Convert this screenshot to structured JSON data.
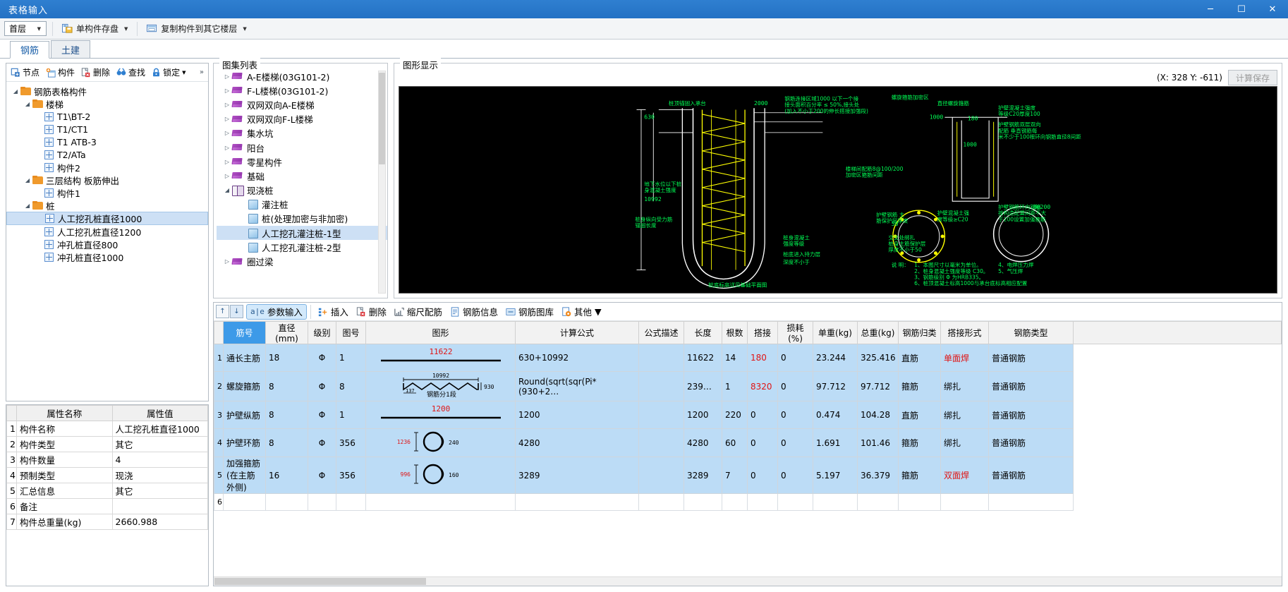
{
  "window": {
    "title": "表格输入",
    "minimize": "─",
    "maximize": "☐",
    "close": "✕"
  },
  "ribbon": {
    "floor_select": "首层",
    "buttons": [
      {
        "label": "单构件存盘",
        "icon": "save-component-icon",
        "has_arrow": true
      },
      {
        "label": "复制构件到其它楼层",
        "icon": "copy-component-icon",
        "has_arrow": true
      }
    ]
  },
  "tabs": [
    {
      "label": "钢筋",
      "active": true
    },
    {
      "label": "土建",
      "active": false
    }
  ],
  "tree_toolbar": {
    "buttons": [
      {
        "label": "节点",
        "icon": "node-icon",
        "has_arrow": false
      },
      {
        "label": "构件",
        "icon": "component-icon",
        "has_arrow": false
      },
      {
        "label": "删除",
        "icon": "delete-icon",
        "has_arrow": false
      },
      {
        "label": "查找",
        "icon": "find-icon",
        "has_arrow": false
      },
      {
        "label": "锁定",
        "icon": "lock-icon",
        "has_arrow": true
      }
    ],
    "overflow": "»"
  },
  "tree": [
    {
      "label": "钢筋表格构件",
      "type": "folder",
      "depth": 0,
      "expanded": true,
      "selected": false
    },
    {
      "label": "楼梯",
      "type": "folder",
      "depth": 1,
      "expanded": true,
      "selected": false
    },
    {
      "label": "T1\\BT-2",
      "type": "component",
      "depth": 2,
      "expanded": false,
      "selected": false
    },
    {
      "label": "T1/CT1",
      "type": "component",
      "depth": 2,
      "expanded": false,
      "selected": false
    },
    {
      "label": "T1 ATB-3",
      "type": "component",
      "depth": 2,
      "expanded": false,
      "selected": false
    },
    {
      "label": "T2/ATa",
      "type": "component",
      "depth": 2,
      "expanded": false,
      "selected": false
    },
    {
      "label": "构件2",
      "type": "component",
      "depth": 2,
      "expanded": false,
      "selected": false
    },
    {
      "label": "三层结构 板筋伸出",
      "type": "folder",
      "depth": 1,
      "expanded": true,
      "selected": false
    },
    {
      "label": "构件1",
      "type": "component",
      "depth": 2,
      "expanded": false,
      "selected": false
    },
    {
      "label": "桩",
      "type": "folder",
      "depth": 1,
      "expanded": true,
      "selected": false
    },
    {
      "label": "人工挖孔桩直径1000",
      "type": "component",
      "depth": 2,
      "expanded": false,
      "selected": true
    },
    {
      "label": "人工挖孔桩直径1200",
      "type": "component",
      "depth": 2,
      "expanded": false,
      "selected": false
    },
    {
      "label": "冲孔桩直径800",
      "type": "component",
      "depth": 2,
      "expanded": false,
      "selected": false
    },
    {
      "label": "冲孔桩直径1000",
      "type": "component",
      "depth": 2,
      "expanded": false,
      "selected": false
    }
  ],
  "properties": {
    "headers": [
      "",
      "属性名称",
      "属性值"
    ],
    "rows": [
      {
        "n": "1",
        "name": "构件名称",
        "value": "人工挖孔桩直径1000"
      },
      {
        "n": "2",
        "name": "构件类型",
        "value": "其它"
      },
      {
        "n": "3",
        "name": "构件数量",
        "value": "4"
      },
      {
        "n": "4",
        "name": "预制类型",
        "value": "现浇"
      },
      {
        "n": "5",
        "name": "汇总信息",
        "value": "其它"
      },
      {
        "n": "6",
        "name": "备注",
        "value": ""
      },
      {
        "n": "7",
        "name": "构件总重量(kg)",
        "value": "2660.988"
      }
    ]
  },
  "atlas": {
    "caption": "图集列表",
    "items": [
      {
        "label": "A-E楼梯(03G101-2)",
        "icon": "book-icon",
        "depth": 0,
        "expanded": false,
        "selected": false
      },
      {
        "label": "F-L楼梯(03G101-2)",
        "icon": "book-icon",
        "depth": 0,
        "expanded": false,
        "selected": false
      },
      {
        "label": "双网双向A-E楼梯",
        "icon": "book-icon",
        "depth": 0,
        "expanded": false,
        "selected": false
      },
      {
        "label": "双网双向F-L楼梯",
        "icon": "book-icon",
        "depth": 0,
        "expanded": false,
        "selected": false
      },
      {
        "label": "集水坑",
        "icon": "book-icon",
        "depth": 0,
        "expanded": false,
        "selected": false
      },
      {
        "label": "阳台",
        "icon": "book-icon",
        "depth": 0,
        "expanded": false,
        "selected": false
      },
      {
        "label": "零星构件",
        "icon": "book-icon",
        "depth": 0,
        "expanded": false,
        "selected": false
      },
      {
        "label": "基础",
        "icon": "book-icon",
        "depth": 0,
        "expanded": false,
        "selected": false
      },
      {
        "label": "现浇桩",
        "icon": "book-open-icon",
        "depth": 0,
        "expanded": true,
        "selected": false
      },
      {
        "label": "灌注桩",
        "icon": "page-icon",
        "depth": 1,
        "expanded": null,
        "selected": false
      },
      {
        "label": "桩(处理加密与非加密)",
        "icon": "page-icon",
        "depth": 1,
        "expanded": null,
        "selected": false
      },
      {
        "label": "人工挖孔灌注桩-1型",
        "icon": "page-icon",
        "depth": 1,
        "expanded": null,
        "selected": true
      },
      {
        "label": "人工挖孔灌注桩-2型",
        "icon": "page-icon",
        "depth": 1,
        "expanded": null,
        "selected": false
      },
      {
        "label": "圈过梁",
        "icon": "book-icon",
        "depth": 0,
        "expanded": false,
        "selected": false
      }
    ]
  },
  "graphic": {
    "caption": "图形显示",
    "coordinates": "(X: 328 Y: -611)",
    "calc_button": "计算保存"
  },
  "rebar_toolbar": {
    "up": "↑",
    "down": "↓",
    "buttons": [
      {
        "label": "参数输入",
        "icon": "param-input-icon",
        "active": true,
        "has_arrow": false
      },
      {
        "label": "插入",
        "icon": "insert-icon",
        "active": false,
        "has_arrow": false
      },
      {
        "label": "删除",
        "icon": "delete-icon",
        "active": false,
        "has_arrow": false
      },
      {
        "label": "缩尺配筋",
        "icon": "scale-rebar-icon",
        "active": false,
        "has_arrow": false
      },
      {
        "label": "钢筋信息",
        "icon": "rebar-info-icon",
        "active": false,
        "has_arrow": false
      },
      {
        "label": "钢筋图库",
        "icon": "rebar-library-icon",
        "active": false,
        "has_arrow": false
      },
      {
        "label": "其他",
        "icon": "other-icon",
        "active": false,
        "has_arrow": true
      }
    ]
  },
  "rebar_table": {
    "headers": [
      "筋号",
      "直径(mm)",
      "级别",
      "图号",
      "图形",
      "计算公式",
      "公式描述",
      "长度",
      "根数",
      "搭接",
      "损耗(%)",
      "单重(kg)",
      "总重(kg)",
      "钢筋归类",
      "搭接形式",
      "钢筋类型"
    ],
    "rows": [
      {
        "n": "1",
        "name": "通长主筋",
        "diameter": "18",
        "grade": "Φ",
        "figure_no": "1",
        "shape_kind": "straight",
        "shape_label": "11622",
        "shape_label_color": "#e01414",
        "formula": "630+10992",
        "formula_desc": "",
        "length": "11622",
        "count": "14",
        "lap": "180",
        "lap_color": "#e01414",
        "loss": "0",
        "unit_weight": "23.244",
        "total_weight": "325.416",
        "category": "直筋",
        "lap_form": "单面焊",
        "lap_form_color": "#e01414",
        "rebar_type": "普通钢筋"
      },
      {
        "n": "2",
        "name": "螺旋箍筋",
        "diameter": "8",
        "grade": "Φ",
        "figure_no": "8",
        "shape_kind": "spiral",
        "shape_top": "10992",
        "shape_right": "930",
        "shape_bottom": "137",
        "shape_caption": "钢筋分1段",
        "formula": "Round(sqrt(sqr(Pi*(930+2…",
        "formula_desc": "",
        "length": "239…",
        "count": "1",
        "lap": "8320",
        "lap_color": "#e01414",
        "loss": "0",
        "unit_weight": "97.712",
        "total_weight": "97.712",
        "category": "箍筋",
        "lap_form": "绑扎",
        "lap_form_color": "#000000",
        "rebar_type": "普通钢筋"
      },
      {
        "n": "3",
        "name": "护壁纵筋",
        "diameter": "8",
        "grade": "Φ",
        "figure_no": "1",
        "shape_kind": "straight",
        "shape_label": "1200",
        "shape_label_color": "#e01414",
        "formula": "1200",
        "formula_desc": "",
        "length": "1200",
        "count": "220",
        "lap": "0",
        "lap_color": "#000000",
        "loss": "0",
        "unit_weight": "0.474",
        "total_weight": "104.28",
        "category": "直筋",
        "lap_form": "绑扎",
        "lap_form_color": "#000000",
        "rebar_type": "普通钢筋"
      },
      {
        "n": "4",
        "name": "护壁环筋",
        "diameter": "8",
        "grade": "Φ",
        "figure_no": "356",
        "shape_kind": "circle",
        "shape_left": "1236",
        "shape_right": "240",
        "formula": "4280",
        "formula_desc": "",
        "length": "4280",
        "count": "60",
        "lap": "0",
        "lap_color": "#000000",
        "loss": "0",
        "unit_weight": "1.691",
        "total_weight": "101.46",
        "category": "箍筋",
        "lap_form": "绑扎",
        "lap_form_color": "#000000",
        "rebar_type": "普通钢筋"
      },
      {
        "n": "5",
        "name": "加强箍筋(在主筋外侧)",
        "diameter": "16",
        "grade": "Φ",
        "figure_no": "356",
        "shape_kind": "circle",
        "shape_left": "996",
        "shape_right": "160",
        "formula": "3289",
        "formula_desc": "",
        "length": "3289",
        "count": "7",
        "lap": "0",
        "lap_color": "#000000",
        "loss": "0",
        "unit_weight": "5.197",
        "total_weight": "36.379",
        "category": "箍筋",
        "lap_form": "双面焊",
        "lap_form_color": "#e01414",
        "rebar_type": "普通钢筋"
      },
      {
        "n": "6",
        "name": "",
        "diameter": "",
        "grade": "",
        "figure_no": "",
        "shape_kind": "none",
        "formula": "",
        "formula_desc": "",
        "length": "",
        "count": "",
        "lap": "",
        "loss": "",
        "unit_weight": "",
        "total_weight": "",
        "category": "",
        "lap_form": "",
        "rebar_type": "",
        "empty": true
      }
    ]
  },
  "colors": {
    "title_bar": "#2472c4",
    "selection": "#cde0f5",
    "row_fill": "#bcdcf6",
    "accent_red": "#e01414",
    "header_sel": "#3d9ae8"
  }
}
